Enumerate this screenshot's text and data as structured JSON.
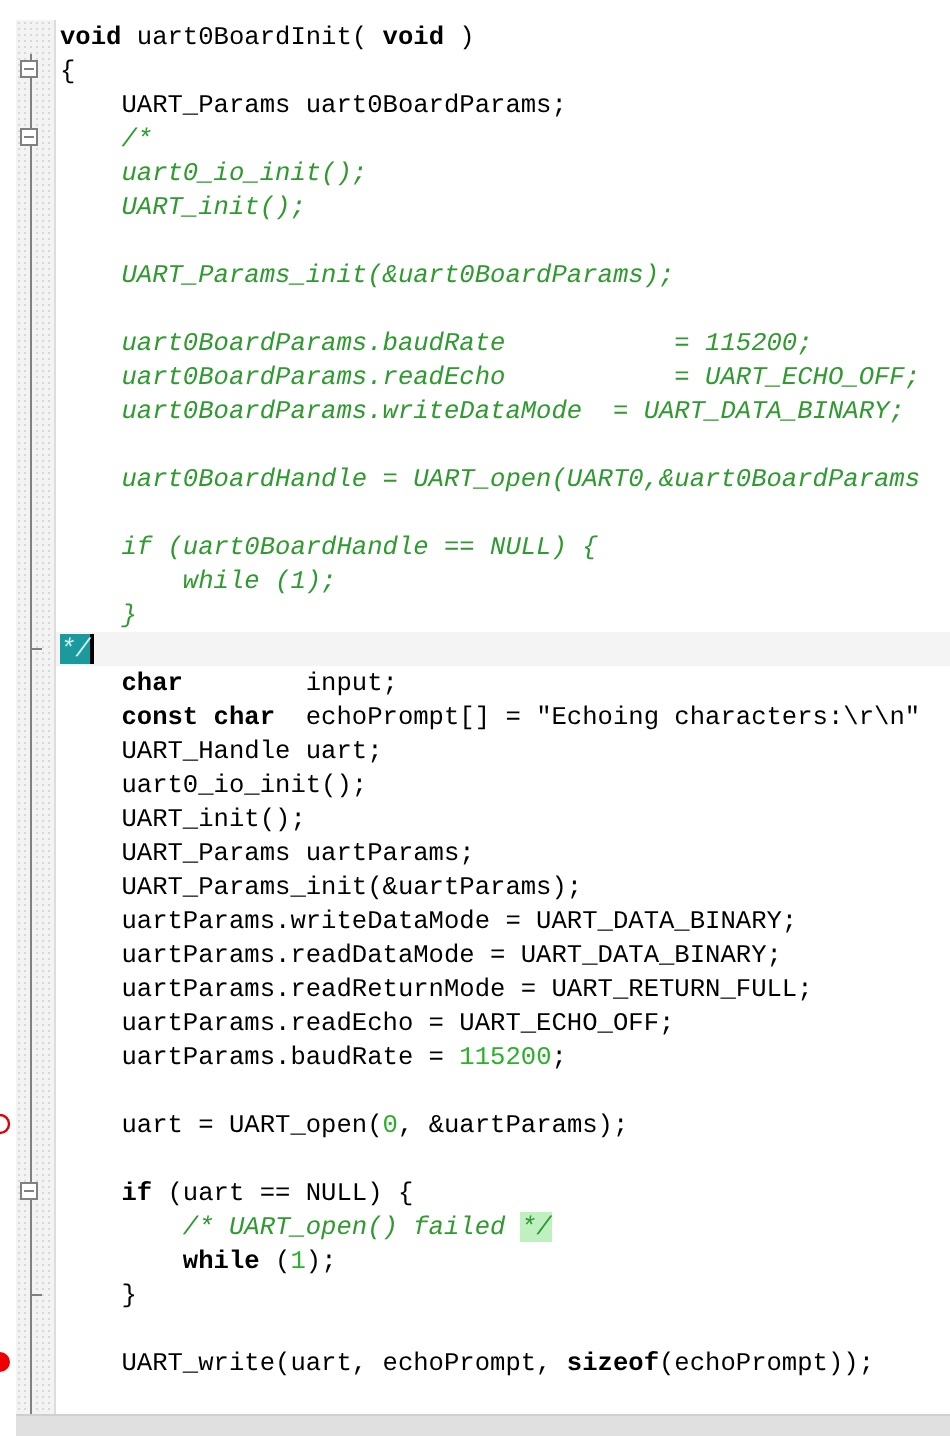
{
  "lines": [
    {
      "kind": "code",
      "segments": [
        {
          "text": "void",
          "kind": "keyword"
        },
        {
          "text": " uart0BoardInit( ",
          "kind": "plain"
        },
        {
          "text": "void",
          "kind": "keyword"
        },
        {
          "text": " )",
          "kind": "plain"
        }
      ]
    },
    {
      "kind": "code",
      "fold_start": true,
      "segments": [
        {
          "text": "{",
          "kind": "plain"
        }
      ]
    },
    {
      "kind": "code",
      "segments": [
        {
          "text": "    UART_Params uart0BoardParams;",
          "kind": "plain"
        }
      ]
    },
    {
      "kind": "code",
      "fold_start": true,
      "segments": [
        {
          "text": "    /*",
          "kind": "comment"
        }
      ]
    },
    {
      "kind": "code",
      "segments": [
        {
          "text": "    uart0_io_init();",
          "kind": "comment"
        }
      ]
    },
    {
      "kind": "code",
      "segments": [
        {
          "text": "    UART_init();",
          "kind": "comment"
        }
      ]
    },
    {
      "kind": "blank"
    },
    {
      "kind": "code",
      "segments": [
        {
          "text": "    UART_Params_init(&uart0BoardParams);",
          "kind": "comment"
        }
      ]
    },
    {
      "kind": "blank"
    },
    {
      "kind": "code",
      "segments": [
        {
          "text": "    uart0BoardParams.baudRate           = 115200;",
          "kind": "comment"
        }
      ]
    },
    {
      "kind": "code",
      "segments": [
        {
          "text": "    uart0BoardParams.readEcho           = UART_ECHO_OFF;",
          "kind": "comment"
        }
      ]
    },
    {
      "kind": "code",
      "segments": [
        {
          "text": "    uart0BoardParams.writeDataMode  = UART_DATA_BINARY;",
          "kind": "comment"
        }
      ]
    },
    {
      "kind": "blank"
    },
    {
      "kind": "code",
      "segments": [
        {
          "text": "    uart0BoardHandle = UART_open(UART0,&uart0BoardParams",
          "kind": "comment"
        }
      ]
    },
    {
      "kind": "blank"
    },
    {
      "kind": "code",
      "segments": [
        {
          "text": "    if (uart0BoardHandle == NULL) {",
          "kind": "comment"
        }
      ]
    },
    {
      "kind": "code",
      "segments": [
        {
          "text": "        while (1);",
          "kind": "comment"
        }
      ]
    },
    {
      "kind": "code",
      "segments": [
        {
          "text": "    }",
          "kind": "comment"
        }
      ]
    },
    {
      "kind": "code",
      "fold_end": true,
      "current": true,
      "segments": [
        {
          "text": "*/",
          "kind": "mark"
        }
      ]
    },
    {
      "kind": "code",
      "segments": [
        {
          "text": "    char",
          "kind": "keyword"
        },
        {
          "text": "        input;",
          "kind": "plain"
        }
      ]
    },
    {
      "kind": "code",
      "segments": [
        {
          "text": "    const char",
          "kind": "keyword"
        },
        {
          "text": "  echoPrompt[] = \"Echoing characters:\\r\\n\"",
          "kind": "plain"
        }
      ]
    },
    {
      "kind": "code",
      "segments": [
        {
          "text": "    UART_Handle uart;",
          "kind": "plain"
        }
      ]
    },
    {
      "kind": "code",
      "segments": [
        {
          "text": "    uart0_io_init();",
          "kind": "plain"
        }
      ]
    },
    {
      "kind": "code",
      "segments": [
        {
          "text": "    UART_init();",
          "kind": "plain"
        }
      ]
    },
    {
      "kind": "code",
      "segments": [
        {
          "text": "    UART_Params uartParams;",
          "kind": "plain"
        }
      ]
    },
    {
      "kind": "code",
      "segments": [
        {
          "text": "    UART_Params_init(&uartParams);",
          "kind": "plain"
        }
      ]
    },
    {
      "kind": "code",
      "segments": [
        {
          "text": "    uartParams.writeDataMode = UART_DATA_BINARY;",
          "kind": "plain"
        }
      ]
    },
    {
      "kind": "code",
      "segments": [
        {
          "text": "    uartParams.readDataMode = UART_DATA_BINARY;",
          "kind": "plain"
        }
      ]
    },
    {
      "kind": "code",
      "segments": [
        {
          "text": "    uartParams.readReturnMode = UART_RETURN_FULL;",
          "kind": "plain"
        }
      ]
    },
    {
      "kind": "code",
      "segments": [
        {
          "text": "    uartParams.readEcho = UART_ECHO_OFF;",
          "kind": "plain"
        }
      ]
    },
    {
      "kind": "code",
      "segments": [
        {
          "text": "    uartParams.baudRate = ",
          "kind": "plain"
        },
        {
          "text": "115200",
          "kind": "number"
        },
        {
          "text": ";",
          "kind": "plain"
        }
      ]
    },
    {
      "kind": "blank"
    },
    {
      "kind": "code",
      "breakpoint": true,
      "breakpoint_enabled": false,
      "segments": [
        {
          "text": "    uart = UART_open(",
          "kind": "plain"
        },
        {
          "text": "0",
          "kind": "number"
        },
        {
          "text": ", &uartParams);",
          "kind": "plain"
        }
      ]
    },
    {
      "kind": "blank"
    },
    {
      "kind": "code",
      "fold_start": true,
      "segments": [
        {
          "text": "    if",
          "kind": "keyword"
        },
        {
          "text": " (uart == NULL) {",
          "kind": "plain"
        }
      ]
    },
    {
      "kind": "code",
      "segments": [
        {
          "text": "        /* UART_open() failed ",
          "kind": "comment"
        },
        {
          "text": "*/",
          "kind": "match"
        }
      ]
    },
    {
      "kind": "code",
      "segments": [
        {
          "text": "        while",
          "kind": "keyword"
        },
        {
          "text": " (",
          "kind": "plain"
        },
        {
          "text": "1",
          "kind": "number"
        },
        {
          "text": ");",
          "kind": "plain"
        }
      ]
    },
    {
      "kind": "code",
      "fold_end": true,
      "segments": [
        {
          "text": "    }",
          "kind": "plain"
        }
      ]
    },
    {
      "kind": "blank"
    },
    {
      "kind": "code",
      "breakpoint": true,
      "breakpoint_enabled": true,
      "segments": [
        {
          "text": "    UART_write(uart, echoPrompt, ",
          "kind": "plain"
        },
        {
          "text": "sizeof",
          "kind": "keyword"
        },
        {
          "text": "(echoPrompt));",
          "kind": "plain"
        }
      ]
    },
    {
      "kind": "blank"
    }
  ]
}
